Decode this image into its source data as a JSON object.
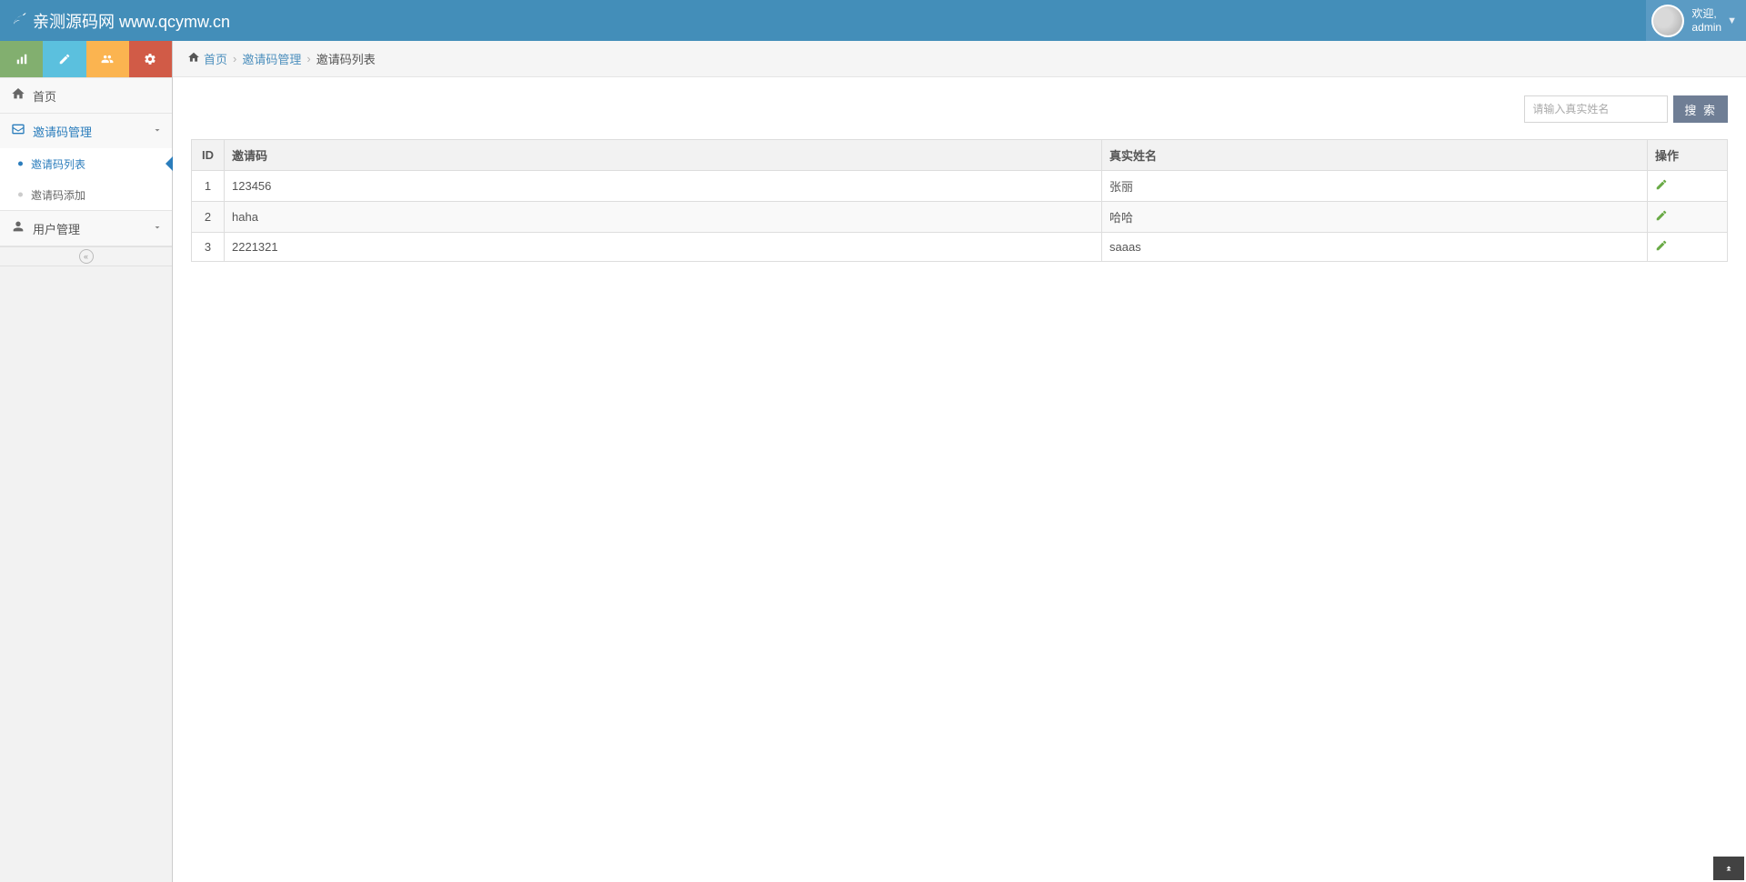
{
  "brand": {
    "name": "亲测源码网 www.qcymw.cn"
  },
  "user": {
    "welcome": "欢迎,",
    "name": "admin"
  },
  "sidebar": {
    "home": "首页",
    "invite_mgmt": "邀请码管理",
    "invite_list": "邀请码列表",
    "invite_add": "邀请码添加",
    "user_mgmt": "用户管理"
  },
  "breadcrumb": {
    "home": "首页",
    "l1": "邀请码管理",
    "l2": "邀请码列表"
  },
  "search": {
    "placeholder": "请输入真实姓名",
    "button": "搜 索"
  },
  "table": {
    "headers": {
      "id": "ID",
      "code": "邀请码",
      "name": "真实姓名",
      "op": "操作"
    },
    "rows": [
      {
        "id": "1",
        "code": "123456",
        "name": "张丽"
      },
      {
        "id": "2",
        "code": "haha",
        "name": "哈哈"
      },
      {
        "id": "3",
        "code": "2221321",
        "name": "saaas"
      }
    ]
  }
}
